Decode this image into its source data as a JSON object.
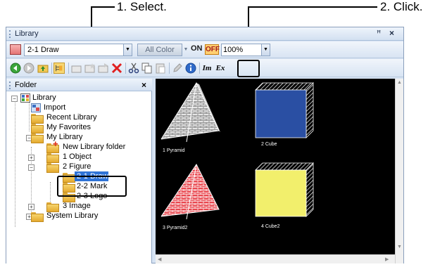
{
  "callouts": {
    "step1": "1. Select.",
    "step2": "2. Click."
  },
  "window": {
    "title": "Library",
    "pin_glyph": "ꟸ",
    "close_glyph": "×"
  },
  "toolbar1": {
    "library_select": "2-1 Draw",
    "color_mode": "All Color",
    "on_label": "ON",
    "off_label": "OFF",
    "zoom_value": "100%"
  },
  "toolbar2": {
    "im_label": "Im",
    "ex_label": "Ex"
  },
  "folder_pane": {
    "title": "Folder",
    "close_glyph": "×",
    "tree": [
      {
        "label": "Library"
      },
      {
        "label": "Import"
      },
      {
        "label": "Recent Library"
      },
      {
        "label": "My Favorites"
      },
      {
        "label": "My Library"
      },
      {
        "label": "New Library folder"
      },
      {
        "label": "1 Object"
      },
      {
        "label": "2 Figure"
      },
      {
        "label": "2-1 Draw"
      },
      {
        "label": "2-2 Mark"
      },
      {
        "label": "2-3 Logo"
      },
      {
        "label": "3 Image"
      },
      {
        "label": "System Library"
      }
    ]
  },
  "thumbnails": [
    {
      "label": "1 Pyramid"
    },
    {
      "label": "2 Cube"
    },
    {
      "label": "3 Pyramid2"
    },
    {
      "label": "4 Cube2"
    }
  ],
  "colors": {
    "cube_blue": "#2a4fa3",
    "cube_yellow": "#f2ef6c",
    "pyramid_red": "#e8424a",
    "pyramid_white": "#d9d9d9",
    "selection": "#2f73d6"
  }
}
